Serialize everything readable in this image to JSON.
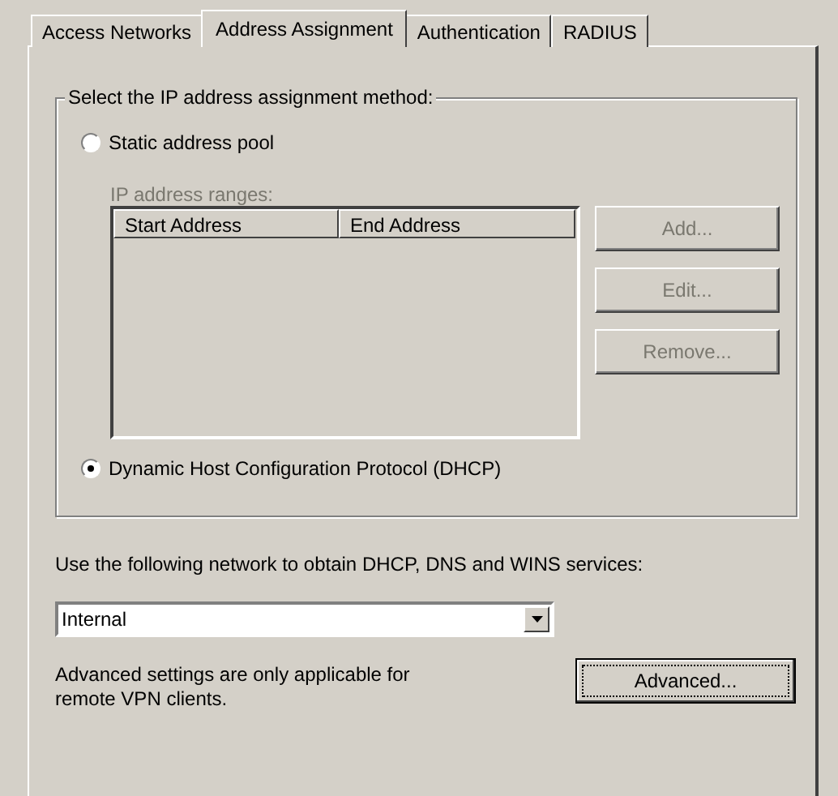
{
  "tabs": [
    {
      "label": "Access Networks",
      "selected": false
    },
    {
      "label": "Address Assignment",
      "selected": true
    },
    {
      "label": "Authentication",
      "selected": false
    },
    {
      "label": "RADIUS",
      "selected": false
    }
  ],
  "assignment_group": {
    "legend": "Select the IP address assignment method:",
    "options": [
      {
        "label": "Static address pool",
        "selected": false
      },
      {
        "label": "Dynamic Host Configuration Protocol (DHCP)",
        "selected": true
      }
    ],
    "ranges": {
      "label": "IP address ranges:",
      "disabled": true,
      "columns": [
        "Start Address",
        "End Address"
      ],
      "buttons": [
        {
          "label": "Add...",
          "disabled": true
        },
        {
          "label": "Edit...",
          "disabled": true
        },
        {
          "label": "Remove...",
          "disabled": true
        }
      ]
    }
  },
  "network": {
    "label": "Use the following network to obtain DHCP, DNS and WINS services:",
    "select": {
      "value": "Internal"
    }
  },
  "advanced": {
    "note": "Advanced settings are only applicable for remote VPN clients.",
    "button": {
      "label": "Advanced...",
      "focused": true
    }
  }
}
